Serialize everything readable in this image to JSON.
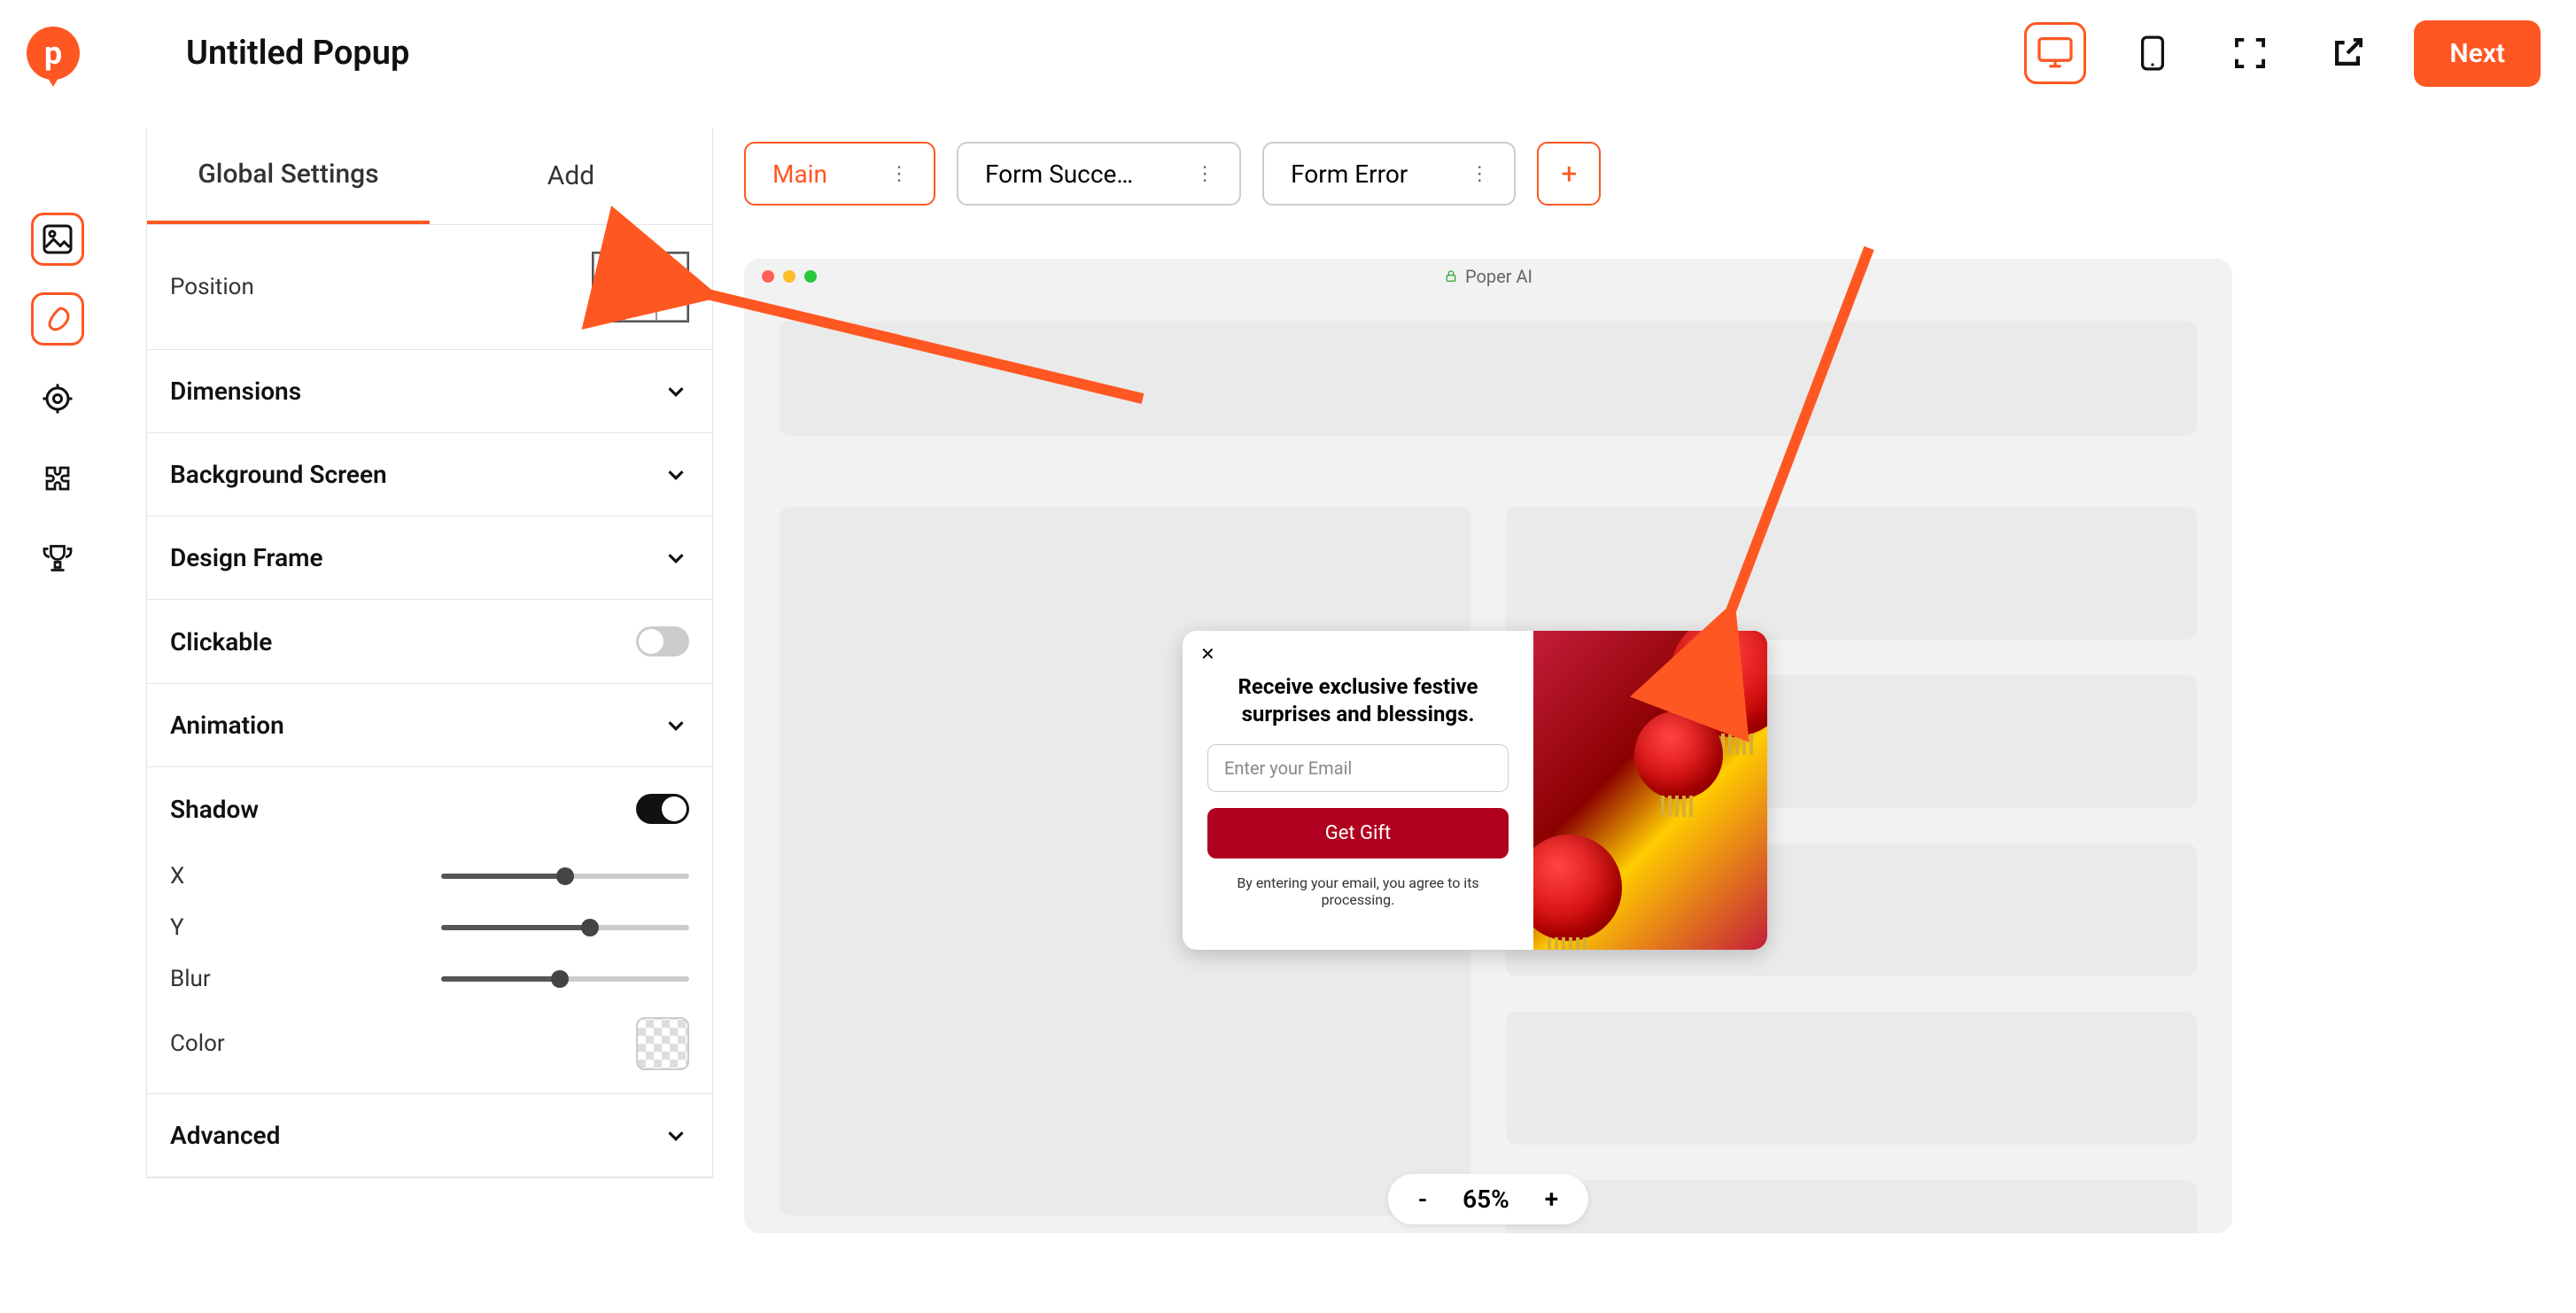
{
  "header": {
    "title": "Untitled Popup",
    "next": "Next"
  },
  "rail": {
    "items": [
      "image",
      "brush",
      "target",
      "puzzle",
      "trophy"
    ]
  },
  "tabs": {
    "global": "Global Settings",
    "add": "Add"
  },
  "panel": {
    "position": "Position",
    "dimensions": "Dimensions",
    "background": "Background Screen",
    "frame": "Design Frame",
    "clickable": "Clickable",
    "animation": "Animation",
    "shadow": "Shadow",
    "x": "X",
    "y": "Y",
    "blur": "Blur",
    "color": "Color",
    "advanced": "Advanced"
  },
  "states": {
    "main": "Main",
    "success": "Form Succe…",
    "error": "Form Error",
    "add": "+"
  },
  "preview": {
    "site": "Poper AI",
    "popup": {
      "title": "Receive exclusive festive surprises and blessings.",
      "placeholder": "Enter your Email",
      "button": "Get Gift",
      "foot": "By entering your email, you agree to its processing."
    }
  },
  "zoom": {
    "minus": "-",
    "value": "65%",
    "plus": "+"
  }
}
